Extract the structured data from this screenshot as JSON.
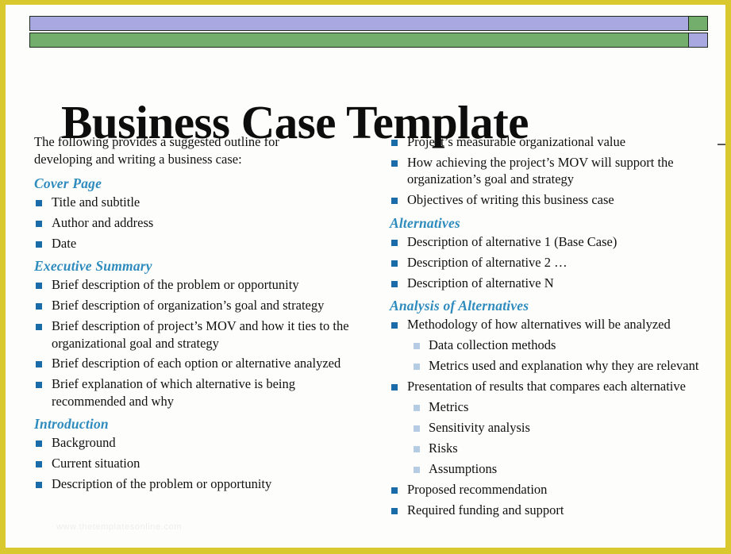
{
  "slide": {
    "title": "Business Case Template",
    "watermark": "www.thetemplatesonline.com",
    "accent_heading_color": "#2e8bbd",
    "bullet_color": "#1a6ca8",
    "subbullet_color": "#b6cbe4",
    "frame_color": "#d9c82e",
    "banner_lavender": "#a9a8e0",
    "banner_green": "#74ae6c"
  },
  "banner": {
    "top_row": [
      {
        "name": "lavender-long",
        "color_key": "lavender"
      },
      {
        "name": "green-short",
        "color_key": "green"
      }
    ],
    "bottom_row": [
      {
        "name": "green-long",
        "color_key": "green"
      },
      {
        "name": "lavender-short",
        "color_key": "lavender"
      }
    ]
  },
  "left_column": {
    "intro": "The following provides a suggested outline for developing and writing a business case:",
    "sections": [
      {
        "heading": "Cover Page",
        "items": [
          {
            "text": "Title and subtitle",
            "level": 1
          },
          {
            "text": "Author and address",
            "level": 1
          },
          {
            "text": "Date",
            "level": 1
          }
        ]
      },
      {
        "heading": "Executive Summary",
        "items": [
          {
            "text": "Brief description of the problem or opportunity",
            "level": 1
          },
          {
            "text": "Brief description of organization’s goal and strategy",
            "level": 1
          },
          {
            "text": "Brief description of project’s MOV and how it ties to the organizational goal and strategy",
            "level": 1
          },
          {
            "text": "Brief description of each option or alternative analyzed",
            "level": 1
          },
          {
            "text": "Brief explanation of which alternative is being recommended and why",
            "level": 1
          }
        ]
      },
      {
        "heading": "Introduction",
        "items": [
          {
            "text": "Background",
            "level": 1
          },
          {
            "text": "Current situation",
            "level": 1
          },
          {
            "text": "Description of the problem or opportunity",
            "level": 1
          }
        ]
      }
    ]
  },
  "right_column": {
    "continued_items": [
      {
        "text": "Project’s measurable organizational value",
        "level": 1
      },
      {
        "text": "How achieving the project’s MOV will support the organization’s goal and strategy",
        "level": 1
      },
      {
        "text": "Objectives of writing this business case",
        "level": 1
      }
    ],
    "sections": [
      {
        "heading": "Alternatives",
        "items": [
          {
            "text": "Description of alternative 1 (Base Case)",
            "level": 1
          },
          {
            "text": "Description of alternative 2 …",
            "level": 1
          },
          {
            "text": "Description of alternative N",
            "level": 1
          }
        ]
      },
      {
        "heading": "Analysis of Alternatives",
        "items": [
          {
            "text": "Methodology of how alternatives will be analyzed",
            "level": 1
          },
          {
            "text": "Data collection methods",
            "level": 2
          },
          {
            "text": "Metrics used and explanation why they are relevant",
            "level": 2
          },
          {
            "text": "Presentation of results that compares each alternative",
            "level": 1
          },
          {
            "text": "Metrics",
            "level": 2
          },
          {
            "text": "Sensitivity analysis",
            "level": 2
          },
          {
            "text": "Risks",
            "level": 2
          },
          {
            "text": "Assumptions",
            "level": 2
          },
          {
            "text": "Proposed recommendation",
            "level": 1
          },
          {
            "text": "Required funding and support",
            "level": 1
          }
        ]
      }
    ]
  }
}
